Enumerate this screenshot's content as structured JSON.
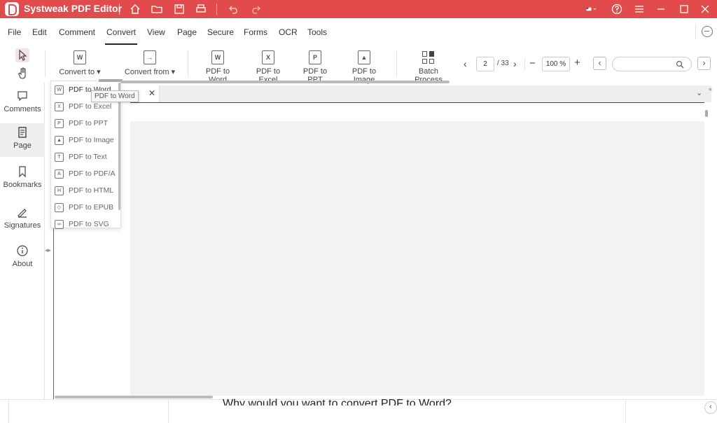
{
  "app": {
    "title": "Systweak PDF Editor"
  },
  "titlebar": {
    "icons": [
      "home-icon",
      "folder-icon",
      "save-icon",
      "print-icon",
      "undo-icon",
      "redo-icon",
      "flag-icon",
      "help-icon",
      "menu-icon",
      "minimize-icon",
      "maximize-icon",
      "close-icon"
    ]
  },
  "menu": {
    "items": [
      "File",
      "Edit",
      "Comment",
      "Convert",
      "View",
      "Page",
      "Secure",
      "Forms",
      "OCR",
      "Tools"
    ],
    "active": "Convert"
  },
  "toolbar": {
    "convert_to": "Convert to",
    "convert_from": "Convert from",
    "pdf_to_word": "PDF to Word",
    "pdf_to_excel": "PDF to Excel",
    "pdf_to_ppt": "PDF to PPT",
    "pdf_to_image": "PDF to Image",
    "batch_process": "Batch Process",
    "page_current": "2",
    "page_total": "/ 33",
    "zoom": "100 %"
  },
  "sidebar": {
    "items": [
      "Comments",
      "Page",
      "Bookmarks",
      "Signatures",
      "About"
    ],
    "active": "Page"
  },
  "dropdown": {
    "items": [
      "PDF to Word",
      "PDF to Excel",
      "PDF to PPT",
      "PDF to Image",
      "PDF to Text",
      "PDF to PDF/A",
      "PDF to HTML",
      "PDF to EPUB",
      "PDF to SVG"
    ],
    "tooltip": "PDF to Word"
  },
  "document": {
    "tab_close": "✕",
    "footer_text": "Why would you want to convert PDF to Word?"
  },
  "colors": {
    "titlebar": "#e14b4b",
    "accent": "#e14b4b"
  }
}
